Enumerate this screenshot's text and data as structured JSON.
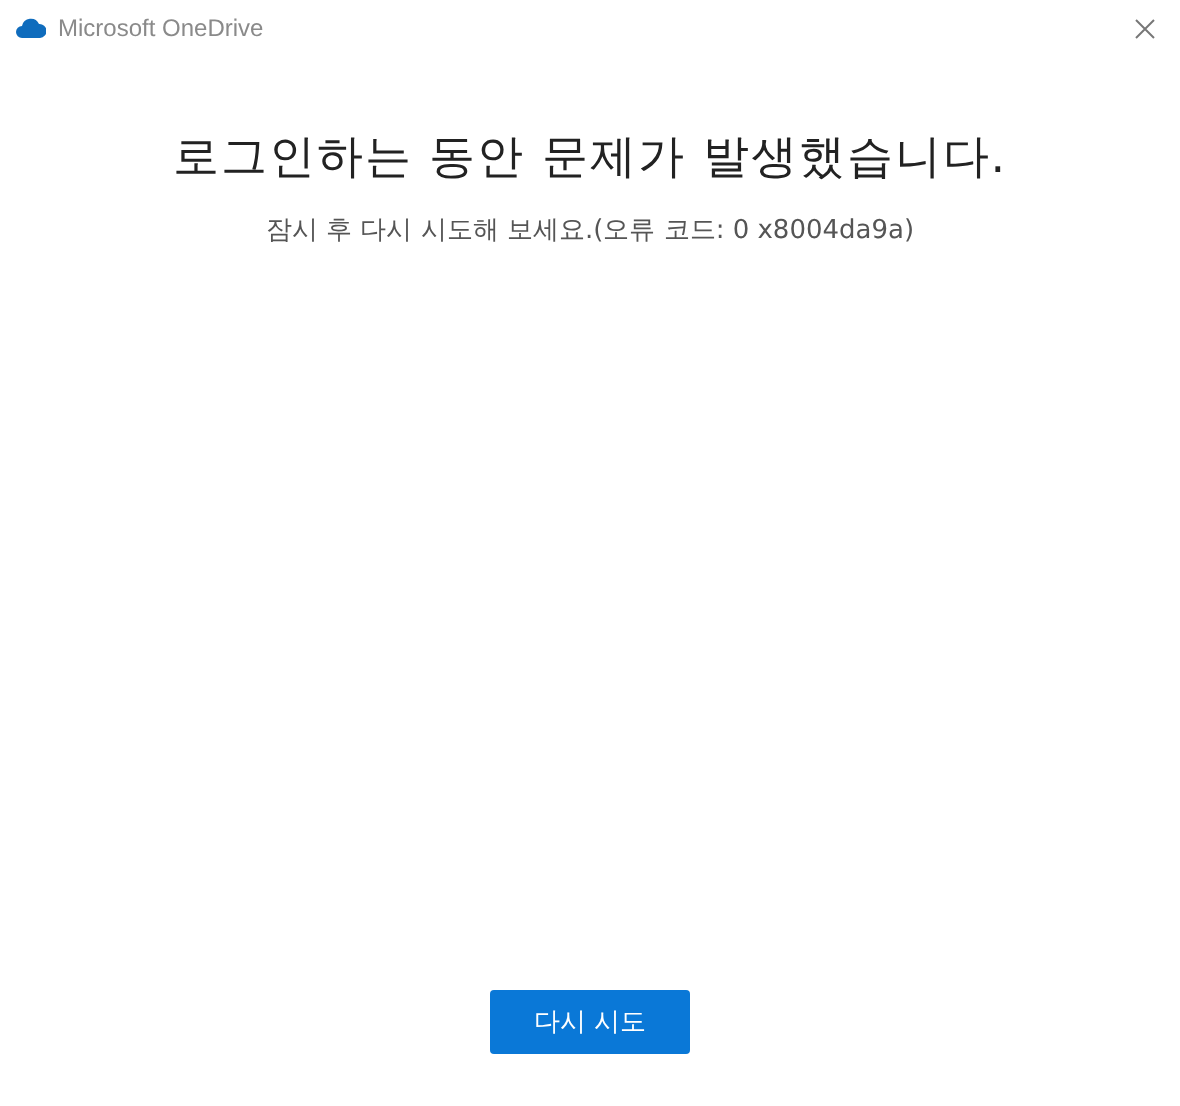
{
  "window": {
    "title": "Microsoft OneDrive"
  },
  "heading": "로그인하는 동안 문제가 발생했습니다.",
  "message": "잠시 후 다시 시도해 보세요.(오류 코드: 0 x8004da9a)",
  "buttons": [
    "다시 시도"
  ]
}
